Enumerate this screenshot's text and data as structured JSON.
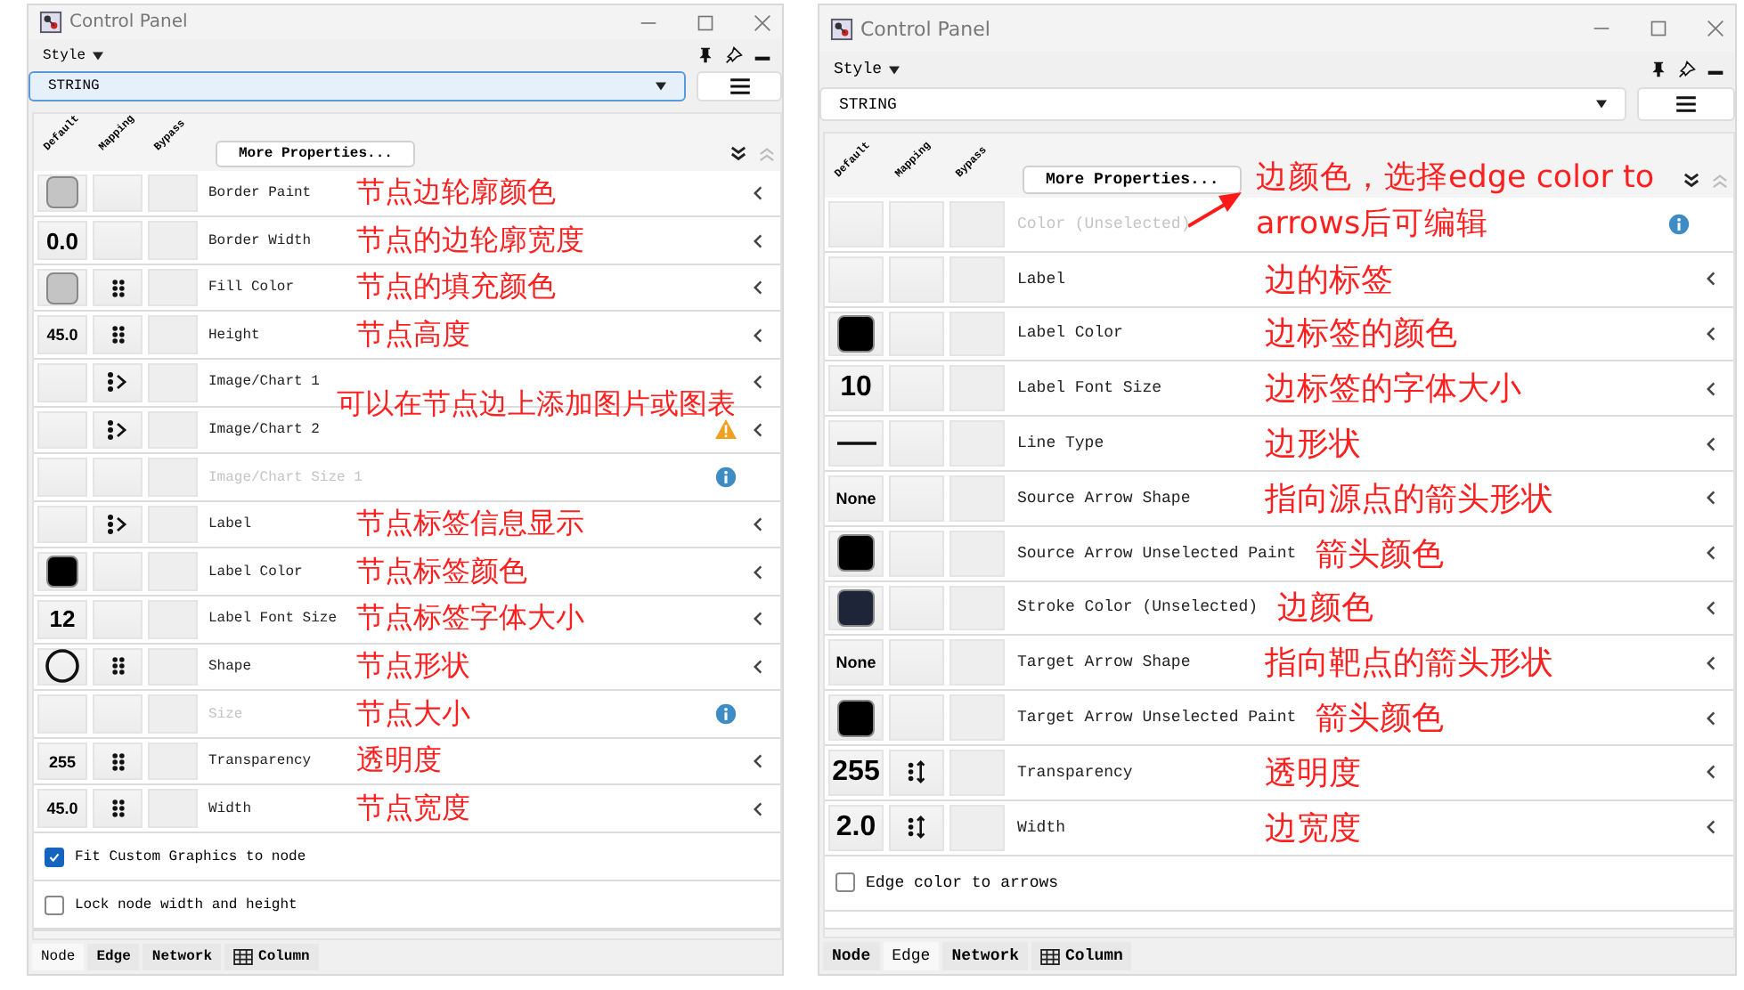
{
  "panels": [
    {
      "window_title": "Control Panel",
      "menu": "Style",
      "style_select": "STRING",
      "column_headers": [
        "Default",
        "Mapping",
        "Bypass"
      ],
      "more_button": "More Properties...",
      "properties": [
        {
          "label": "Border Paint",
          "disabled": false,
          "default": {
            "kind": "swatch",
            "color": "#c4c4c4"
          },
          "mapping": {
            "kind": "none"
          },
          "status": [
            {
              "kind": "collapse"
            }
          ],
          "annotation": {
            "kind": "inline",
            "text": "节点边轮廓颜色"
          }
        },
        {
          "label": "Border Width",
          "disabled": false,
          "default": {
            "kind": "number",
            "value": "0.0"
          },
          "mapping": {
            "kind": "none"
          },
          "status": [
            {
              "kind": "collapse"
            }
          ],
          "annotation": {
            "kind": "inline",
            "text": "节点的边轮廓宽度"
          }
        },
        {
          "label": "Fill Color",
          "disabled": false,
          "default": {
            "kind": "swatch",
            "color": "#c4c4c4"
          },
          "mapping": {
            "kind": "discrete"
          },
          "status": [
            {
              "kind": "collapse"
            }
          ],
          "annotation": {
            "kind": "inline",
            "text": "节点的填充颜色"
          }
        },
        {
          "label": "Height",
          "disabled": false,
          "default": {
            "kind": "small",
            "value": "45.0"
          },
          "mapping": {
            "kind": "discrete"
          },
          "status": [
            {
              "kind": "collapse"
            }
          ],
          "annotation": {
            "kind": "inline",
            "text": "节点高度"
          }
        },
        {
          "label": "Image/Chart 1",
          "disabled": false,
          "default": {
            "kind": "blank"
          },
          "mapping": {
            "kind": "passthrough"
          },
          "status": [
            {
              "kind": "collapse"
            }
          ],
          "annotation": {
            "kind": "between",
            "text": "可以在节点边上添加图片或图表"
          }
        },
        {
          "label": "Image/Chart 2",
          "disabled": false,
          "default": {
            "kind": "blank"
          },
          "mapping": {
            "kind": "passthrough"
          },
          "status": [
            {
              "kind": "warning"
            },
            {
              "kind": "collapse"
            }
          ]
        },
        {
          "label": "Image/Chart Size 1",
          "disabled": true,
          "default": {
            "kind": "blank"
          },
          "mapping": {
            "kind": "none"
          },
          "status": [
            {
              "kind": "info"
            }
          ]
        },
        {
          "label": "Label",
          "disabled": false,
          "default": {
            "kind": "blank"
          },
          "mapping": {
            "kind": "passthrough"
          },
          "status": [
            {
              "kind": "collapse"
            }
          ],
          "annotation": {
            "kind": "inline",
            "text": "节点标签信息显示"
          }
        },
        {
          "label": "Label Color",
          "disabled": false,
          "default": {
            "kind": "swatch",
            "color": "#000000"
          },
          "mapping": {
            "kind": "none"
          },
          "status": [
            {
              "kind": "collapse"
            }
          ],
          "annotation": {
            "kind": "inline",
            "text": "节点标签颜色"
          }
        },
        {
          "label": "Label Font Size",
          "disabled": false,
          "default": {
            "kind": "number",
            "value": "12"
          },
          "mapping": {
            "kind": "none"
          },
          "status": [
            {
              "kind": "collapse"
            }
          ],
          "annotation": {
            "kind": "inline",
            "text": "节点标签字体大小"
          }
        },
        {
          "label": "Shape",
          "disabled": false,
          "default": {
            "kind": "circle"
          },
          "mapping": {
            "kind": "discrete"
          },
          "status": [
            {
              "kind": "collapse"
            }
          ],
          "annotation": {
            "kind": "inline",
            "text": "节点形状"
          }
        },
        {
          "label": "Size",
          "disabled": true,
          "default": {
            "kind": "blank"
          },
          "mapping": {
            "kind": "none"
          },
          "status": [
            {
              "kind": "info"
            }
          ],
          "annotation": {
            "kind": "inline",
            "text": "节点大小"
          }
        },
        {
          "label": "Transparency",
          "disabled": false,
          "default": {
            "kind": "small",
            "value": "255"
          },
          "mapping": {
            "kind": "discrete"
          },
          "status": [
            {
              "kind": "collapse"
            }
          ],
          "annotation": {
            "kind": "inline",
            "text": "透明度"
          }
        },
        {
          "label": "Width",
          "disabled": false,
          "default": {
            "kind": "small",
            "value": "45.0"
          },
          "mapping": {
            "kind": "discrete"
          },
          "status": [
            {
              "kind": "collapse"
            }
          ],
          "annotation": {
            "kind": "inline",
            "text": "节点宽度"
          }
        }
      ],
      "checkboxes": [
        {
          "label": "Fit Custom Graphics to node",
          "checked": true
        },
        {
          "label": "Lock node width and height",
          "checked": false
        }
      ],
      "tabs": [
        {
          "label": "Node",
          "selected": true,
          "kind": "text"
        },
        {
          "label": "Edge",
          "selected": false,
          "kind": "text"
        },
        {
          "label": "Network",
          "selected": false,
          "kind": "text"
        },
        {
          "label": "Column",
          "selected": false,
          "kind": "table"
        }
      ]
    },
    {
      "window_title": "Control Panel",
      "menu": "Style",
      "style_select": "STRING",
      "column_headers": [
        "Default",
        "Mapping",
        "Bypass"
      ],
      "more_button": "More Properties...",
      "properties": [
        {
          "label": "Color (Unselected)",
          "disabled": true,
          "default": {
            "kind": "blank"
          },
          "mapping": {
            "kind": "none"
          },
          "status": [
            {
              "kind": "info"
            }
          ],
          "annotation": {
            "kind": "callout",
            "text": "边颜色，选择edge color to arrows后可编辑"
          }
        },
        {
          "label": "Label",
          "disabled": false,
          "default": {
            "kind": "blank"
          },
          "mapping": {
            "kind": "none"
          },
          "status": [
            {
              "kind": "collapse"
            }
          ],
          "annotation": {
            "kind": "inline",
            "text": "边的标签"
          }
        },
        {
          "label": "Label Color",
          "disabled": false,
          "default": {
            "kind": "swatch",
            "color": "#000000"
          },
          "mapping": {
            "kind": "none"
          },
          "status": [
            {
              "kind": "collapse"
            }
          ],
          "annotation": {
            "kind": "inline",
            "text": "边标签的颜色"
          }
        },
        {
          "label": "Label Font Size",
          "disabled": false,
          "default": {
            "kind": "number",
            "value": "10"
          },
          "mapping": {
            "kind": "none"
          },
          "status": [
            {
              "kind": "collapse"
            }
          ],
          "annotation": {
            "kind": "inline",
            "text": "边标签的字体大小"
          }
        },
        {
          "label": "Line Type",
          "disabled": false,
          "default": {
            "kind": "line"
          },
          "mapping": {
            "kind": "none"
          },
          "status": [
            {
              "kind": "collapse"
            }
          ],
          "annotation": {
            "kind": "inline",
            "text": "边形状"
          }
        },
        {
          "label": "Source Arrow Shape",
          "disabled": false,
          "default": {
            "kind": "small",
            "value": "None"
          },
          "mapping": {
            "kind": "none"
          },
          "status": [
            {
              "kind": "collapse"
            }
          ],
          "annotation": {
            "kind": "inline",
            "text": "指向源点的箭头形状"
          }
        },
        {
          "label": "Source Arrow Unselected Paint",
          "disabled": false,
          "default": {
            "kind": "swatch",
            "color": "#000000"
          },
          "mapping": {
            "kind": "none"
          },
          "status": [
            {
              "kind": "collapse"
            }
          ],
          "annotation": {
            "kind": "inline",
            "text": "箭头颜色"
          }
        },
        {
          "label": "Stroke Color (Unselected)",
          "disabled": false,
          "default": {
            "kind": "swatch",
            "color": "#1e2538"
          },
          "mapping": {
            "kind": "none"
          },
          "status": [
            {
              "kind": "collapse"
            }
          ],
          "annotation": {
            "kind": "inline",
            "text": "边颜色"
          }
        },
        {
          "label": "Target Arrow Shape",
          "disabled": false,
          "default": {
            "kind": "small",
            "value": "None"
          },
          "mapping": {
            "kind": "none"
          },
          "status": [
            {
              "kind": "collapse"
            }
          ],
          "annotation": {
            "kind": "inline",
            "text": "指向靶点的箭头形状"
          }
        },
        {
          "label": "Target Arrow Unselected Paint",
          "disabled": false,
          "default": {
            "kind": "swatch",
            "color": "#000000"
          },
          "mapping": {
            "kind": "none"
          },
          "status": [
            {
              "kind": "collapse"
            }
          ],
          "annotation": {
            "kind": "inline",
            "text": "箭头颜色"
          }
        },
        {
          "label": "Transparency",
          "disabled": false,
          "default": {
            "kind": "number",
            "value": "255"
          },
          "mapping": {
            "kind": "continuous"
          },
          "status": [
            {
              "kind": "collapse"
            }
          ],
          "annotation": {
            "kind": "inline",
            "text": "透明度"
          }
        },
        {
          "label": "Width",
          "disabled": false,
          "default": {
            "kind": "number",
            "value": "2.0"
          },
          "mapping": {
            "kind": "continuous"
          },
          "status": [
            {
              "kind": "collapse"
            }
          ],
          "annotation": {
            "kind": "inline",
            "text": "边宽度"
          }
        }
      ],
      "checkboxes": [
        {
          "label": "Edge color to arrows",
          "checked": false
        }
      ],
      "tabs": [
        {
          "label": "Node",
          "selected": false,
          "kind": "text"
        },
        {
          "label": "Edge",
          "selected": true,
          "kind": "text"
        },
        {
          "label": "Network",
          "selected": false,
          "kind": "text"
        },
        {
          "label": "Column",
          "selected": false,
          "kind": "table"
        }
      ]
    }
  ]
}
